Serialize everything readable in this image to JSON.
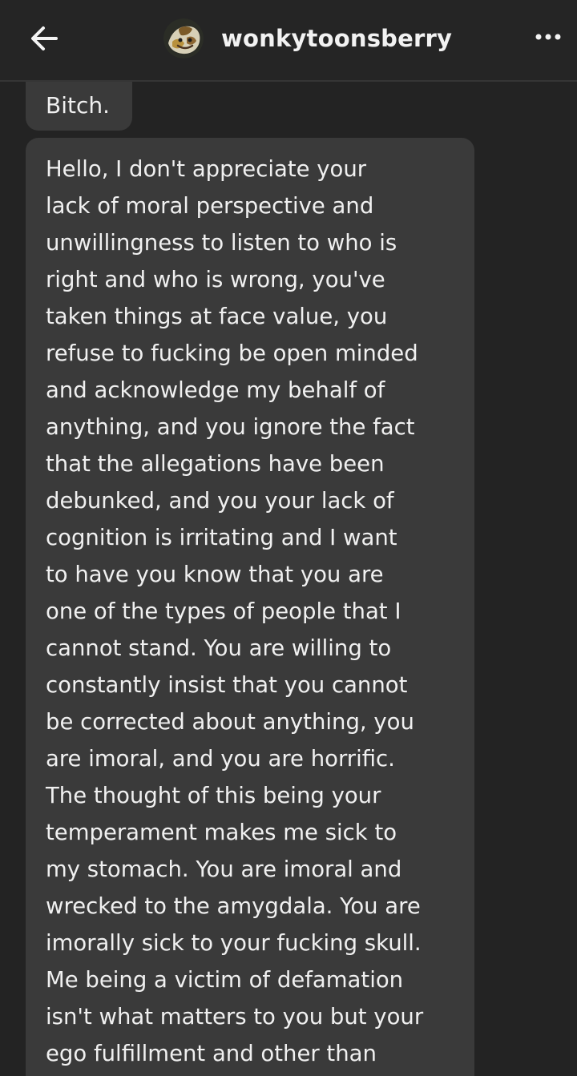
{
  "header": {
    "back_icon": "arrow-left-icon",
    "username": "wonkytoonsberry",
    "avatar_icon": "avatar-image",
    "more_icon": "more-horizontal-icon"
  },
  "messages": [
    {
      "text": "Bitch."
    },
    {
      "lines": [
        "Hello, I don't appreciate your",
        "lack of moral perspective and",
        "unwillingness to listen to who is",
        "right and who is wrong, you've",
        "taken things at face value, you",
        "refuse to fucking be open minded",
        "and acknowledge my behalf of",
        "anything, and you ignore the fact",
        "that the allegations have been",
        "debunked, and you your lack of",
        "cognition is irritating and I want",
        "to have you know that you are",
        "one of the types of people that I",
        "cannot stand. You are willing to",
        "constantly insist that you cannot",
        "be corrected about anything, you",
        "are imoral, and you are horrific.",
        "The thought of this being your",
        "temperament makes me sick to",
        "my stomach. You are imoral and",
        "wrecked to the amygdala. You are",
        "imorally sick to your fucking skull.",
        "Me being a victim of defamation",
        "isn't what matters to you but your",
        "ego fulfillment and other than"
      ]
    }
  ],
  "colors": {
    "background": "#232323",
    "bubble": "#3a3a3a",
    "text": "#f0f0f0"
  }
}
